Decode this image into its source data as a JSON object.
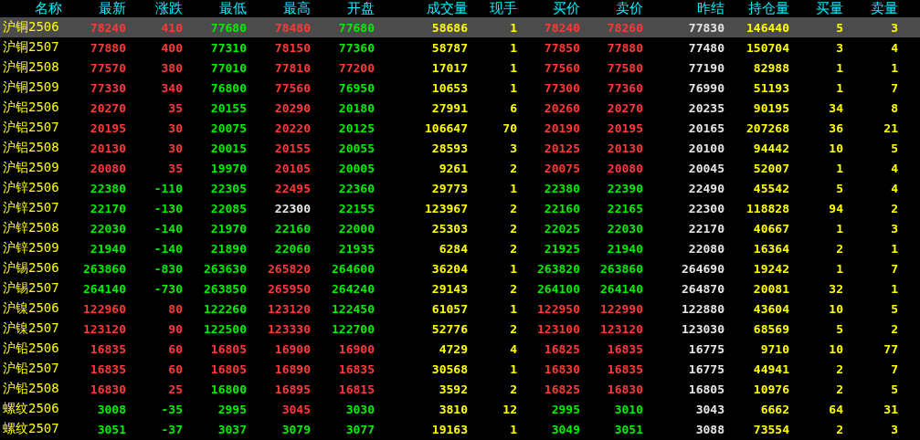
{
  "columns": [
    "名称",
    "最新",
    "涨跌",
    "最低",
    "最高",
    "开盘",
    "成交量",
    "现手",
    "买价",
    "卖价",
    "昨结",
    "持仓量",
    "买量",
    "卖量"
  ],
  "rows": [
    {
      "name": "沪铜2506",
      "selected": true,
      "last": {
        "value": "78240",
        "color": "#ff3838"
      },
      "change": {
        "value": "410",
        "color": "#ff3838"
      },
      "low": {
        "value": "77680",
        "color": "#00ee00"
      },
      "high": {
        "value": "78480",
        "color": "#ff3838"
      },
      "open": {
        "value": "77680",
        "color": "#00ee00"
      },
      "volume": "58686",
      "current_hand": "1",
      "bid": {
        "value": "78240",
        "color": "#ff3838"
      },
      "ask": {
        "value": "78260",
        "color": "#ff3838"
      },
      "prev_settle": "77830",
      "open_interest": "146440",
      "bid_size": "5",
      "ask_size": "3"
    },
    {
      "name": "沪铜2507",
      "selected": false,
      "last": {
        "value": "77880",
        "color": "#ff3838"
      },
      "change": {
        "value": "400",
        "color": "#ff3838"
      },
      "low": {
        "value": "77310",
        "color": "#00ee00"
      },
      "high": {
        "value": "78150",
        "color": "#ff3838"
      },
      "open": {
        "value": "77360",
        "color": "#00ee00"
      },
      "volume": "58787",
      "current_hand": "1",
      "bid": {
        "value": "77850",
        "color": "#ff3838"
      },
      "ask": {
        "value": "77880",
        "color": "#ff3838"
      },
      "prev_settle": "77480",
      "open_interest": "150704",
      "bid_size": "3",
      "ask_size": "4"
    },
    {
      "name": "沪铜2508",
      "selected": false,
      "last": {
        "value": "77570",
        "color": "#ff3838"
      },
      "change": {
        "value": "380",
        "color": "#ff3838"
      },
      "low": {
        "value": "77010",
        "color": "#00ee00"
      },
      "high": {
        "value": "77810",
        "color": "#ff3838"
      },
      "open": {
        "value": "77200",
        "color": "#ff3838"
      },
      "volume": "17017",
      "current_hand": "1",
      "bid": {
        "value": "77560",
        "color": "#ff3838"
      },
      "ask": {
        "value": "77580",
        "color": "#ff3838"
      },
      "prev_settle": "77190",
      "open_interest": "82988",
      "bid_size": "1",
      "ask_size": "1"
    },
    {
      "name": "沪铜2509",
      "selected": false,
      "last": {
        "value": "77330",
        "color": "#ff3838"
      },
      "change": {
        "value": "340",
        "color": "#ff3838"
      },
      "low": {
        "value": "76800",
        "color": "#00ee00"
      },
      "high": {
        "value": "77560",
        "color": "#ff3838"
      },
      "open": {
        "value": "76950",
        "color": "#00ee00"
      },
      "volume": "10653",
      "current_hand": "1",
      "bid": {
        "value": "77300",
        "color": "#ff3838"
      },
      "ask": {
        "value": "77360",
        "color": "#ff3838"
      },
      "prev_settle": "76990",
      "open_interest": "51193",
      "bid_size": "1",
      "ask_size": "7"
    },
    {
      "name": "沪铝2506",
      "selected": false,
      "last": {
        "value": "20270",
        "color": "#ff3838"
      },
      "change": {
        "value": "35",
        "color": "#ff3838"
      },
      "low": {
        "value": "20155",
        "color": "#00ee00"
      },
      "high": {
        "value": "20290",
        "color": "#ff3838"
      },
      "open": {
        "value": "20180",
        "color": "#00ee00"
      },
      "volume": "27991",
      "current_hand": "6",
      "bid": {
        "value": "20260",
        "color": "#ff3838"
      },
      "ask": {
        "value": "20270",
        "color": "#ff3838"
      },
      "prev_settle": "20235",
      "open_interest": "90195",
      "bid_size": "34",
      "ask_size": "8"
    },
    {
      "name": "沪铝2507",
      "selected": false,
      "last": {
        "value": "20195",
        "color": "#ff3838"
      },
      "change": {
        "value": "30",
        "color": "#ff3838"
      },
      "low": {
        "value": "20075",
        "color": "#00ee00"
      },
      "high": {
        "value": "20220",
        "color": "#ff3838"
      },
      "open": {
        "value": "20125",
        "color": "#00ee00"
      },
      "volume": "106647",
      "current_hand": "70",
      "bid": {
        "value": "20190",
        "color": "#ff3838"
      },
      "ask": {
        "value": "20195",
        "color": "#ff3838"
      },
      "prev_settle": "20165",
      "open_interest": "207268",
      "bid_size": "36",
      "ask_size": "21"
    },
    {
      "name": "沪铝2508",
      "selected": false,
      "last": {
        "value": "20130",
        "color": "#ff3838"
      },
      "change": {
        "value": "30",
        "color": "#ff3838"
      },
      "low": {
        "value": "20015",
        "color": "#00ee00"
      },
      "high": {
        "value": "20155",
        "color": "#ff3838"
      },
      "open": {
        "value": "20055",
        "color": "#00ee00"
      },
      "volume": "28593",
      "current_hand": "3",
      "bid": {
        "value": "20125",
        "color": "#ff3838"
      },
      "ask": {
        "value": "20130",
        "color": "#ff3838"
      },
      "prev_settle": "20100",
      "open_interest": "94442",
      "bid_size": "10",
      "ask_size": "5"
    },
    {
      "name": "沪铝2509",
      "selected": false,
      "last": {
        "value": "20080",
        "color": "#ff3838"
      },
      "change": {
        "value": "35",
        "color": "#ff3838"
      },
      "low": {
        "value": "19970",
        "color": "#00ee00"
      },
      "high": {
        "value": "20105",
        "color": "#ff3838"
      },
      "open": {
        "value": "20005",
        "color": "#00ee00"
      },
      "volume": "9261",
      "current_hand": "2",
      "bid": {
        "value": "20075",
        "color": "#ff3838"
      },
      "ask": {
        "value": "20080",
        "color": "#ff3838"
      },
      "prev_settle": "20045",
      "open_interest": "52007",
      "bid_size": "1",
      "ask_size": "4"
    },
    {
      "name": "沪锌2506",
      "selected": false,
      "last": {
        "value": "22380",
        "color": "#00ee00"
      },
      "change": {
        "value": "-110",
        "color": "#00ee00"
      },
      "low": {
        "value": "22305",
        "color": "#00ee00"
      },
      "high": {
        "value": "22495",
        "color": "#ff3838"
      },
      "open": {
        "value": "22360",
        "color": "#00ee00"
      },
      "volume": "29773",
      "current_hand": "1",
      "bid": {
        "value": "22380",
        "color": "#00ee00"
      },
      "ask": {
        "value": "22390",
        "color": "#00ee00"
      },
      "prev_settle": "22490",
      "open_interest": "45542",
      "bid_size": "5",
      "ask_size": "4"
    },
    {
      "name": "沪锌2507",
      "selected": false,
      "last": {
        "value": "22170",
        "color": "#00ee00"
      },
      "change": {
        "value": "-130",
        "color": "#00ee00"
      },
      "low": {
        "value": "22085",
        "color": "#00ee00"
      },
      "high": {
        "value": "22300",
        "color": "#e6e6e6"
      },
      "open": {
        "value": "22155",
        "color": "#00ee00"
      },
      "volume": "123967",
      "current_hand": "2",
      "bid": {
        "value": "22160",
        "color": "#00ee00"
      },
      "ask": {
        "value": "22165",
        "color": "#00ee00"
      },
      "prev_settle": "22300",
      "open_interest": "118828",
      "bid_size": "94",
      "ask_size": "2"
    },
    {
      "name": "沪锌2508",
      "selected": false,
      "last": {
        "value": "22030",
        "color": "#00ee00"
      },
      "change": {
        "value": "-140",
        "color": "#00ee00"
      },
      "low": {
        "value": "21970",
        "color": "#00ee00"
      },
      "high": {
        "value": "22160",
        "color": "#00ee00"
      },
      "open": {
        "value": "22000",
        "color": "#00ee00"
      },
      "volume": "25303",
      "current_hand": "2",
      "bid": {
        "value": "22025",
        "color": "#00ee00"
      },
      "ask": {
        "value": "22030",
        "color": "#00ee00"
      },
      "prev_settle": "22170",
      "open_interest": "40667",
      "bid_size": "1",
      "ask_size": "3"
    },
    {
      "name": "沪锌2509",
      "selected": false,
      "last": {
        "value": "21940",
        "color": "#00ee00"
      },
      "change": {
        "value": "-140",
        "color": "#00ee00"
      },
      "low": {
        "value": "21890",
        "color": "#00ee00"
      },
      "high": {
        "value": "22060",
        "color": "#00ee00"
      },
      "open": {
        "value": "21935",
        "color": "#00ee00"
      },
      "volume": "6284",
      "current_hand": "2",
      "bid": {
        "value": "21925",
        "color": "#00ee00"
      },
      "ask": {
        "value": "21940",
        "color": "#00ee00"
      },
      "prev_settle": "22080",
      "open_interest": "16364",
      "bid_size": "2",
      "ask_size": "1"
    },
    {
      "name": "沪锡2506",
      "selected": false,
      "last": {
        "value": "263860",
        "color": "#00ee00"
      },
      "change": {
        "value": "-830",
        "color": "#00ee00"
      },
      "low": {
        "value": "263630",
        "color": "#00ee00"
      },
      "high": {
        "value": "265820",
        "color": "#ff3838"
      },
      "open": {
        "value": "264600",
        "color": "#00ee00"
      },
      "volume": "36204",
      "current_hand": "1",
      "bid": {
        "value": "263820",
        "color": "#00ee00"
      },
      "ask": {
        "value": "263860",
        "color": "#00ee00"
      },
      "prev_settle": "264690",
      "open_interest": "19242",
      "bid_size": "1",
      "ask_size": "7"
    },
    {
      "name": "沪锡2507",
      "selected": false,
      "last": {
        "value": "264140",
        "color": "#00ee00"
      },
      "change": {
        "value": "-730",
        "color": "#00ee00"
      },
      "low": {
        "value": "263850",
        "color": "#00ee00"
      },
      "high": {
        "value": "265950",
        "color": "#ff3838"
      },
      "open": {
        "value": "264240",
        "color": "#00ee00"
      },
      "volume": "29143",
      "current_hand": "2",
      "bid": {
        "value": "264100",
        "color": "#00ee00"
      },
      "ask": {
        "value": "264140",
        "color": "#00ee00"
      },
      "prev_settle": "264870",
      "open_interest": "20081",
      "bid_size": "32",
      "ask_size": "1"
    },
    {
      "name": "沪镍2506",
      "selected": false,
      "last": {
        "value": "122960",
        "color": "#ff3838"
      },
      "change": {
        "value": "80",
        "color": "#ff3838"
      },
      "low": {
        "value": "122260",
        "color": "#00ee00"
      },
      "high": {
        "value": "123120",
        "color": "#ff3838"
      },
      "open": {
        "value": "122450",
        "color": "#00ee00"
      },
      "volume": "61057",
      "current_hand": "1",
      "bid": {
        "value": "122950",
        "color": "#ff3838"
      },
      "ask": {
        "value": "122990",
        "color": "#ff3838"
      },
      "prev_settle": "122880",
      "open_interest": "43604",
      "bid_size": "10",
      "ask_size": "5"
    },
    {
      "name": "沪镍2507",
      "selected": false,
      "last": {
        "value": "123120",
        "color": "#ff3838"
      },
      "change": {
        "value": "90",
        "color": "#ff3838"
      },
      "low": {
        "value": "122500",
        "color": "#00ee00"
      },
      "high": {
        "value": "123330",
        "color": "#ff3838"
      },
      "open": {
        "value": "122700",
        "color": "#00ee00"
      },
      "volume": "52776",
      "current_hand": "2",
      "bid": {
        "value": "123100",
        "color": "#ff3838"
      },
      "ask": {
        "value": "123120",
        "color": "#ff3838"
      },
      "prev_settle": "123030",
      "open_interest": "68569",
      "bid_size": "5",
      "ask_size": "2"
    },
    {
      "name": "沪铅2506",
      "selected": false,
      "last": {
        "value": "16835",
        "color": "#ff3838"
      },
      "change": {
        "value": "60",
        "color": "#ff3838"
      },
      "low": {
        "value": "16805",
        "color": "#ff3838"
      },
      "high": {
        "value": "16900",
        "color": "#ff3838"
      },
      "open": {
        "value": "16900",
        "color": "#ff3838"
      },
      "volume": "4729",
      "current_hand": "4",
      "bid": {
        "value": "16825",
        "color": "#ff3838"
      },
      "ask": {
        "value": "16835",
        "color": "#ff3838"
      },
      "prev_settle": "16775",
      "open_interest": "9710",
      "bid_size": "10",
      "ask_size": "77"
    },
    {
      "name": "沪铅2507",
      "selected": false,
      "last": {
        "value": "16835",
        "color": "#ff3838"
      },
      "change": {
        "value": "60",
        "color": "#ff3838"
      },
      "low": {
        "value": "16805",
        "color": "#ff3838"
      },
      "high": {
        "value": "16890",
        "color": "#ff3838"
      },
      "open": {
        "value": "16835",
        "color": "#ff3838"
      },
      "volume": "30568",
      "current_hand": "1",
      "bid": {
        "value": "16830",
        "color": "#ff3838"
      },
      "ask": {
        "value": "16835",
        "color": "#ff3838"
      },
      "prev_settle": "16775",
      "open_interest": "44941",
      "bid_size": "2",
      "ask_size": "7"
    },
    {
      "name": "沪铅2508",
      "selected": false,
      "last": {
        "value": "16830",
        "color": "#ff3838"
      },
      "change": {
        "value": "25",
        "color": "#ff3838"
      },
      "low": {
        "value": "16800",
        "color": "#00ee00"
      },
      "high": {
        "value": "16895",
        "color": "#ff3838"
      },
      "open": {
        "value": "16815",
        "color": "#ff3838"
      },
      "volume": "3592",
      "current_hand": "2",
      "bid": {
        "value": "16825",
        "color": "#ff3838"
      },
      "ask": {
        "value": "16830",
        "color": "#ff3838"
      },
      "prev_settle": "16805",
      "open_interest": "10976",
      "bid_size": "2",
      "ask_size": "5"
    },
    {
      "name": "螺纹2506",
      "selected": false,
      "last": {
        "value": "3008",
        "color": "#00ee00"
      },
      "change": {
        "value": "-35",
        "color": "#00ee00"
      },
      "low": {
        "value": "2995",
        "color": "#00ee00"
      },
      "high": {
        "value": "3045",
        "color": "#ff3838"
      },
      "open": {
        "value": "3030",
        "color": "#00ee00"
      },
      "volume": "3810",
      "current_hand": "12",
      "bid": {
        "value": "2995",
        "color": "#00ee00"
      },
      "ask": {
        "value": "3010",
        "color": "#00ee00"
      },
      "prev_settle": "3043",
      "open_interest": "6662",
      "bid_size": "64",
      "ask_size": "31"
    },
    {
      "name": "螺纹2507",
      "selected": false,
      "last": {
        "value": "3051",
        "color": "#00ee00"
      },
      "change": {
        "value": "-37",
        "color": "#00ee00"
      },
      "low": {
        "value": "3037",
        "color": "#00ee00"
      },
      "high": {
        "value": "3079",
        "color": "#00ee00"
      },
      "open": {
        "value": "3077",
        "color": "#00ee00"
      },
      "volume": "19163",
      "current_hand": "1",
      "bid": {
        "value": "3049",
        "color": "#00ee00"
      },
      "ask": {
        "value": "3051",
        "color": "#00ee00"
      },
      "prev_settle": "3088",
      "open_interest": "73554",
      "bid_size": "2",
      "ask_size": "3"
    }
  ]
}
